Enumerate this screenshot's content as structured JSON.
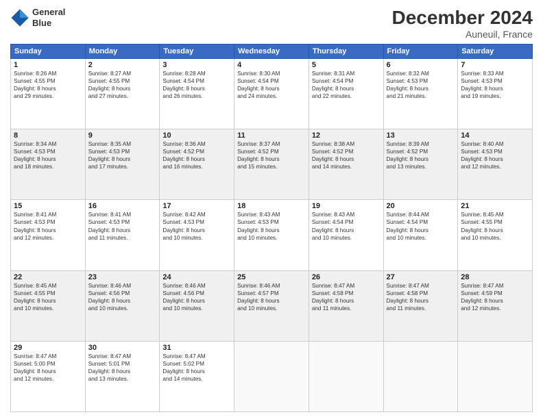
{
  "header": {
    "logo_line1": "General",
    "logo_line2": "Blue",
    "title": "December 2024",
    "subtitle": "Auneuil, France"
  },
  "days_of_week": [
    "Sunday",
    "Monday",
    "Tuesday",
    "Wednesday",
    "Thursday",
    "Friday",
    "Saturday"
  ],
  "weeks": [
    [
      {
        "day": "1",
        "detail": "Sunrise: 8:26 AM\nSunset: 4:55 PM\nDaylight: 8 hours\nand 29 minutes."
      },
      {
        "day": "2",
        "detail": "Sunrise: 8:27 AM\nSunset: 4:55 PM\nDaylight: 8 hours\nand 27 minutes."
      },
      {
        "day": "3",
        "detail": "Sunrise: 8:28 AM\nSunset: 4:54 PM\nDaylight: 8 hours\nand 26 minutes."
      },
      {
        "day": "4",
        "detail": "Sunrise: 8:30 AM\nSunset: 4:54 PM\nDaylight: 8 hours\nand 24 minutes."
      },
      {
        "day": "5",
        "detail": "Sunrise: 8:31 AM\nSunset: 4:54 PM\nDaylight: 8 hours\nand 22 minutes."
      },
      {
        "day": "6",
        "detail": "Sunrise: 8:32 AM\nSunset: 4:53 PM\nDaylight: 8 hours\nand 21 minutes."
      },
      {
        "day": "7",
        "detail": "Sunrise: 8:33 AM\nSunset: 4:53 PM\nDaylight: 8 hours\nand 19 minutes."
      }
    ],
    [
      {
        "day": "8",
        "detail": "Sunrise: 8:34 AM\nSunset: 4:53 PM\nDaylight: 8 hours\nand 18 minutes."
      },
      {
        "day": "9",
        "detail": "Sunrise: 8:35 AM\nSunset: 4:53 PM\nDaylight: 8 hours\nand 17 minutes."
      },
      {
        "day": "10",
        "detail": "Sunrise: 8:36 AM\nSunset: 4:52 PM\nDaylight: 8 hours\nand 16 minutes."
      },
      {
        "day": "11",
        "detail": "Sunrise: 8:37 AM\nSunset: 4:52 PM\nDaylight: 8 hours\nand 15 minutes."
      },
      {
        "day": "12",
        "detail": "Sunrise: 8:38 AM\nSunset: 4:52 PM\nDaylight: 8 hours\nand 14 minutes."
      },
      {
        "day": "13",
        "detail": "Sunrise: 8:39 AM\nSunset: 4:52 PM\nDaylight: 8 hours\nand 13 minutes."
      },
      {
        "day": "14",
        "detail": "Sunrise: 8:40 AM\nSunset: 4:53 PM\nDaylight: 8 hours\nand 12 minutes."
      }
    ],
    [
      {
        "day": "15",
        "detail": "Sunrise: 8:41 AM\nSunset: 4:53 PM\nDaylight: 8 hours\nand 12 minutes."
      },
      {
        "day": "16",
        "detail": "Sunrise: 8:41 AM\nSunset: 4:53 PM\nDaylight: 8 hours\nand 11 minutes."
      },
      {
        "day": "17",
        "detail": "Sunrise: 8:42 AM\nSunset: 4:53 PM\nDaylight: 8 hours\nand 10 minutes."
      },
      {
        "day": "18",
        "detail": "Sunrise: 8:43 AM\nSunset: 4:53 PM\nDaylight: 8 hours\nand 10 minutes."
      },
      {
        "day": "19",
        "detail": "Sunrise: 8:43 AM\nSunset: 4:54 PM\nDaylight: 8 hours\nand 10 minutes."
      },
      {
        "day": "20",
        "detail": "Sunrise: 8:44 AM\nSunset: 4:54 PM\nDaylight: 8 hours\nand 10 minutes."
      },
      {
        "day": "21",
        "detail": "Sunrise: 8:45 AM\nSunset: 4:55 PM\nDaylight: 8 hours\nand 10 minutes."
      }
    ],
    [
      {
        "day": "22",
        "detail": "Sunrise: 8:45 AM\nSunset: 4:55 PM\nDaylight: 8 hours\nand 10 minutes."
      },
      {
        "day": "23",
        "detail": "Sunrise: 8:46 AM\nSunset: 4:56 PM\nDaylight: 8 hours\nand 10 minutes."
      },
      {
        "day": "24",
        "detail": "Sunrise: 8:46 AM\nSunset: 4:56 PM\nDaylight: 8 hours\nand 10 minutes."
      },
      {
        "day": "25",
        "detail": "Sunrise: 8:46 AM\nSunset: 4:57 PM\nDaylight: 8 hours\nand 10 minutes."
      },
      {
        "day": "26",
        "detail": "Sunrise: 8:47 AM\nSunset: 4:58 PM\nDaylight: 8 hours\nand 11 minutes."
      },
      {
        "day": "27",
        "detail": "Sunrise: 8:47 AM\nSunset: 4:58 PM\nDaylight: 8 hours\nand 11 minutes."
      },
      {
        "day": "28",
        "detail": "Sunrise: 8:47 AM\nSunset: 4:59 PM\nDaylight: 8 hours\nand 12 minutes."
      }
    ],
    [
      {
        "day": "29",
        "detail": "Sunrise: 8:47 AM\nSunset: 5:00 PM\nDaylight: 8 hours\nand 12 minutes."
      },
      {
        "day": "30",
        "detail": "Sunrise: 8:47 AM\nSunset: 5:01 PM\nDaylight: 8 hours\nand 13 minutes."
      },
      {
        "day": "31",
        "detail": "Sunrise: 8:47 AM\nSunset: 5:02 PM\nDaylight: 8 hours\nand 14 minutes."
      },
      {
        "day": "",
        "detail": ""
      },
      {
        "day": "",
        "detail": ""
      },
      {
        "day": "",
        "detail": ""
      },
      {
        "day": "",
        "detail": ""
      }
    ]
  ]
}
